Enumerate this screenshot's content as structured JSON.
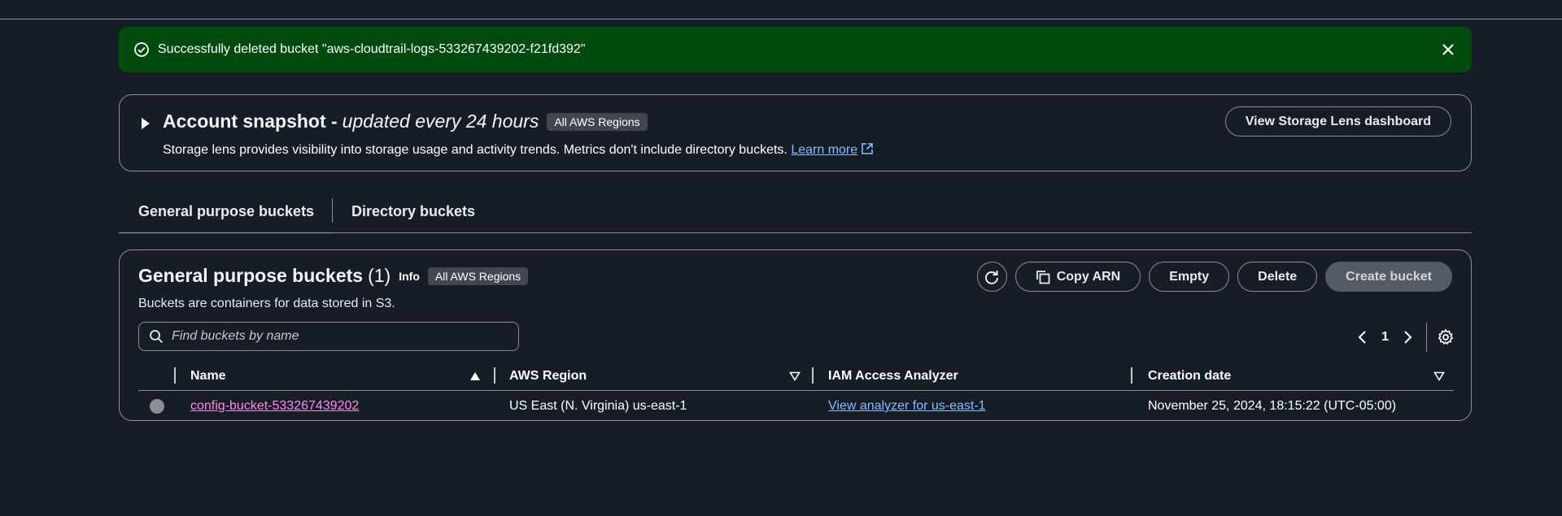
{
  "flash": {
    "message": "Successfully deleted bucket \"aws-cloudtrail-logs-533267439202-f21fd392\"",
    "icon": "check-circle-icon",
    "close_icon": "close-icon"
  },
  "snapshot": {
    "title": "Account snapshot -",
    "title_em": "updated every 24 hours",
    "badge": "All AWS Regions",
    "description": "Storage lens provides visibility into storage usage and activity trends. Metrics don't include directory buckets.",
    "learn_more": "Learn more",
    "lens_button": "View Storage Lens dashboard"
  },
  "tabs": [
    {
      "label": "General purpose buckets",
      "active": true
    },
    {
      "label": "Directory buckets",
      "active": false
    }
  ],
  "buckets": {
    "title": "General purpose buckets",
    "count": "(1)",
    "info": "Info",
    "badge": "All AWS Regions",
    "subtitle": "Buckets are containers for data stored in S3.",
    "actions": {
      "copy_arn": "Copy ARN",
      "empty": "Empty",
      "delete": "Delete",
      "create": "Create bucket"
    },
    "search_placeholder": "Find buckets by name",
    "page": "1",
    "columns": {
      "name": "Name",
      "region": "AWS Region",
      "iam": "IAM Access Analyzer",
      "created": "Creation date"
    },
    "rows": [
      {
        "name": "config-bucket-533267439202",
        "region": "US East (N. Virginia) us-east-1",
        "iam": "View analyzer for us-east-1",
        "created": "November 25, 2024, 18:15:22 (UTC-05:00)"
      }
    ]
  },
  "colors": {
    "background": "#161d26",
    "flash_success": "#014b0f",
    "link_blue": "#89bdff",
    "link_visited": "#ff8aea"
  }
}
